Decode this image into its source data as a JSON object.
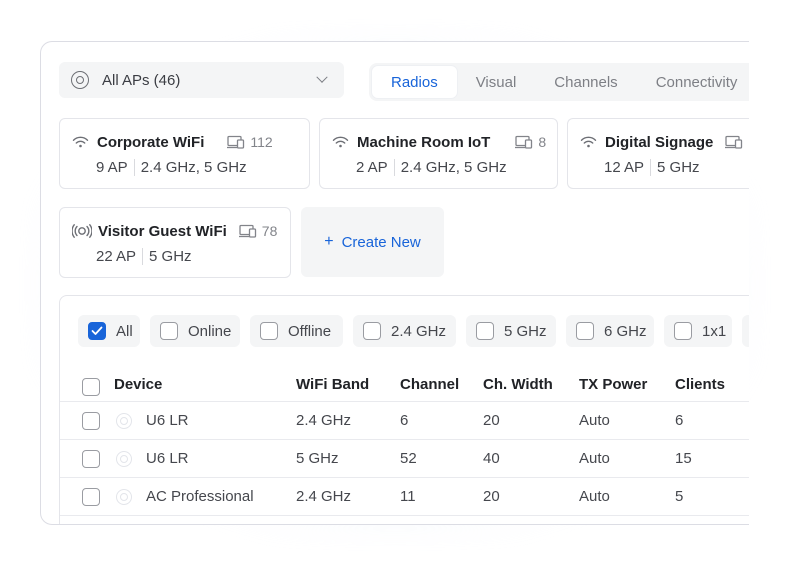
{
  "ap_selector": {
    "label": "All APs (46)",
    "icon": "access-point-icon"
  },
  "tabs": [
    {
      "label": "Radios",
      "active": true
    },
    {
      "label": "Visual",
      "active": false
    },
    {
      "label": "Channels",
      "active": false
    },
    {
      "label": "Connectivity",
      "active": false
    }
  ],
  "networks": [
    {
      "name": "Corporate WiFi",
      "icon": "wifi-icon",
      "count": "112",
      "aps": "9 AP",
      "bands": "2.4 GHz, 5 GHz"
    },
    {
      "name": "Machine Room IoT",
      "icon": "wifi-icon",
      "count": "8",
      "aps": "2 AP",
      "bands": "2.4 GHz, 5 GHz"
    },
    {
      "name": "Digital Signage",
      "icon": "wifi-icon",
      "count": "",
      "aps": "12 AP",
      "bands": "5 GHz"
    },
    {
      "name": "Visitor Guest WiFi",
      "icon": "broadcast-icon",
      "count": "78",
      "aps": "22 AP",
      "bands": "5 GHz"
    }
  ],
  "create_new": {
    "plus": "+",
    "label": "Create New"
  },
  "filters": [
    {
      "label": "All",
      "checked": true
    },
    {
      "label": "Online",
      "checked": false
    },
    {
      "label": "Offline",
      "checked": false
    },
    {
      "label": "2.4 GHz",
      "checked": false
    },
    {
      "label": "5 GHz",
      "checked": false
    },
    {
      "label": "6 GHz",
      "checked": false
    },
    {
      "label": "1x1",
      "checked": false
    }
  ],
  "table": {
    "columns": [
      "Device",
      "WiFi Band",
      "Channel",
      "Ch. Width",
      "TX Power",
      "Clients"
    ],
    "rows": [
      {
        "device": "U6 LR",
        "band": "2.4 GHz",
        "channel": "6",
        "width": "20",
        "power": "Auto",
        "clients": "6"
      },
      {
        "device": "U6 LR",
        "band": "5 GHz",
        "channel": "52",
        "width": "40",
        "power": "Auto",
        "clients": "15"
      },
      {
        "device": "AC Professional",
        "band": "2.4 GHz",
        "channel": "11",
        "width": "20",
        "power": "Auto",
        "clients": "5"
      }
    ]
  },
  "colors": {
    "accent": "#1864d9",
    "text": "#212327",
    "muted": "#7d7f85",
    "chip_bg": "#f4f5f6"
  }
}
